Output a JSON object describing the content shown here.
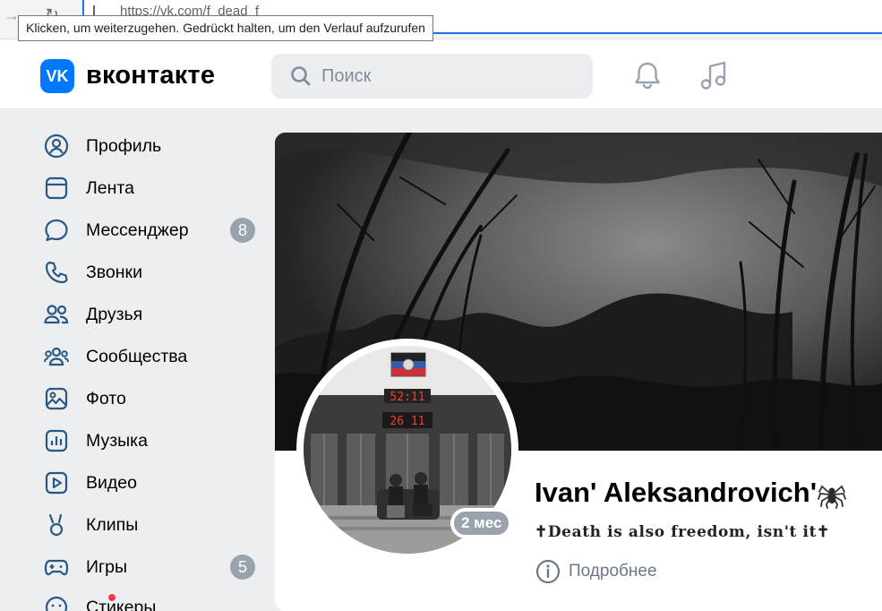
{
  "browser": {
    "url": "https://vk.com/f_dead_f",
    "tooltip": "Klicken, um weiterzugehen. Gedrückt halten, um den Verlauf aufzurufen"
  },
  "header": {
    "logo_text": "VK",
    "wordmark": "вконтакте",
    "search_placeholder": "Поиск",
    "accent_color": "#0077ff"
  },
  "sidebar": {
    "items": [
      {
        "label": "Профиль",
        "icon": "profile-icon"
      },
      {
        "label": "Лента",
        "icon": "feed-icon"
      },
      {
        "label": "Мессенджер",
        "icon": "messenger-icon",
        "badge": "8"
      },
      {
        "label": "Звонки",
        "icon": "calls-icon"
      },
      {
        "label": "Друзья",
        "icon": "friends-icon"
      },
      {
        "label": "Сообщества",
        "icon": "communities-icon"
      },
      {
        "label": "Фото",
        "icon": "photo-icon"
      },
      {
        "label": "Музыка",
        "icon": "music-icon"
      },
      {
        "label": "Видео",
        "icon": "video-icon"
      },
      {
        "label": "Клипы",
        "icon": "clips-icon"
      },
      {
        "label": "Игры",
        "icon": "games-icon",
        "badge": "5"
      },
      {
        "label": "Стикеры",
        "icon": "stickers-icon"
      }
    ]
  },
  "profile": {
    "name": "Ivan' Aleksandrovich'",
    "status": "✝Death is also freedom, isn't it✝",
    "last_seen": "2 мес",
    "details_label": "Подробнее"
  }
}
